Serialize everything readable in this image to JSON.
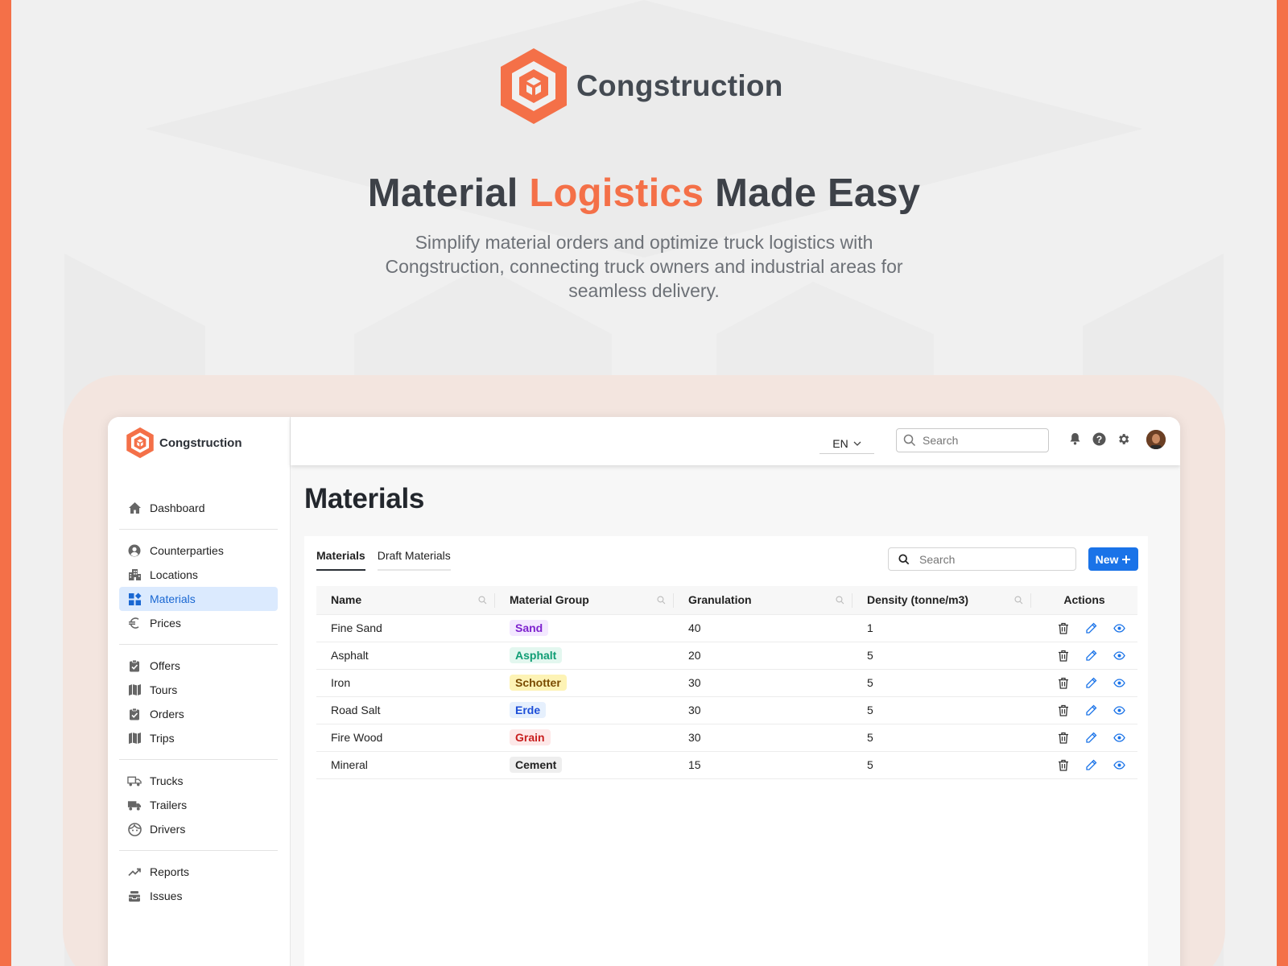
{
  "hero": {
    "brand_name": "Congstruction",
    "title_part1": "Material ",
    "title_highlight": "Logistics",
    "title_part2": " Made Easy",
    "subtitle": "Simplify material orders and optimize truck logistics with Congstruction, connecting truck owners and industrial areas for seamless delivery."
  },
  "colors": {
    "brand": "#f47048",
    "primary": "#1a73e8",
    "active_nav_bg": "#dbeafe"
  },
  "sidebar": {
    "brand_name": "Congstruction",
    "groups": [
      [
        {
          "label": "Dashboard",
          "icon": "home-icon"
        }
      ],
      [
        {
          "label": "Counterparties",
          "icon": "user-circle-icon"
        },
        {
          "label": "Locations",
          "icon": "buildings-icon"
        },
        {
          "label": "Materials",
          "icon": "widgets-icon",
          "active": true
        },
        {
          "label": "Prices",
          "icon": "euro-icon"
        }
      ],
      [
        {
          "label": "Offers",
          "icon": "clipboard-check-icon"
        },
        {
          "label": "Tours",
          "icon": "map-icon"
        },
        {
          "label": "Orders",
          "icon": "clipboard-check-icon"
        },
        {
          "label": "Trips",
          "icon": "map-icon"
        }
      ],
      [
        {
          "label": "Trucks",
          "icon": "truck-icon"
        },
        {
          "label": "Trailers",
          "icon": "trailer-icon"
        },
        {
          "label": "Drivers",
          "icon": "face-icon"
        }
      ],
      [
        {
          "label": "Reports",
          "icon": "trending-up-icon"
        },
        {
          "label": "Issues",
          "icon": "inbox-stack-icon"
        }
      ]
    ]
  },
  "topbar": {
    "language": "EN",
    "search_placeholder": "Search",
    "icons": [
      "bell-icon",
      "help-icon",
      "gear-icon"
    ]
  },
  "page": {
    "title": "Materials",
    "tabs": [
      "Materials",
      "Draft Materials"
    ],
    "search_placeholder": "Search",
    "new_button": "New"
  },
  "table": {
    "columns": [
      "Name",
      "Material Group",
      "Granulation",
      "Density (tonne/m3)",
      "Actions"
    ],
    "rows": [
      {
        "name": "Fine Sand",
        "group": "Sand",
        "group_color": "#7e22ce",
        "group_bg": "#f3e8ff",
        "granulation": "40",
        "density": "1"
      },
      {
        "name": "Asphalt",
        "group": "Asphalt",
        "group_color": "#0f9d74",
        "group_bg": "#e3f7ef",
        "granulation": "20",
        "density": "5"
      },
      {
        "name": "Iron",
        "group": "Schotter",
        "group_color": "#7a4b00",
        "group_bg": "#fdf3b5",
        "granulation": "30",
        "density": "5"
      },
      {
        "name": "Road Salt",
        "group": "Erde",
        "group_color": "#1d4ed8",
        "group_bg": "#e6f0fd",
        "granulation": "30",
        "density": "5"
      },
      {
        "name": "Fire Wood",
        "group": "Grain",
        "group_color": "#c81e1e",
        "group_bg": "#fde8e8",
        "granulation": "30",
        "density": "5"
      },
      {
        "name": "Mineral",
        "group": "Cement",
        "group_color": "#222222",
        "group_bg": "#eeeeee",
        "granulation": "15",
        "density": "5"
      }
    ],
    "row_actions": [
      "trash-icon",
      "pencil-icon",
      "eye-icon"
    ]
  }
}
